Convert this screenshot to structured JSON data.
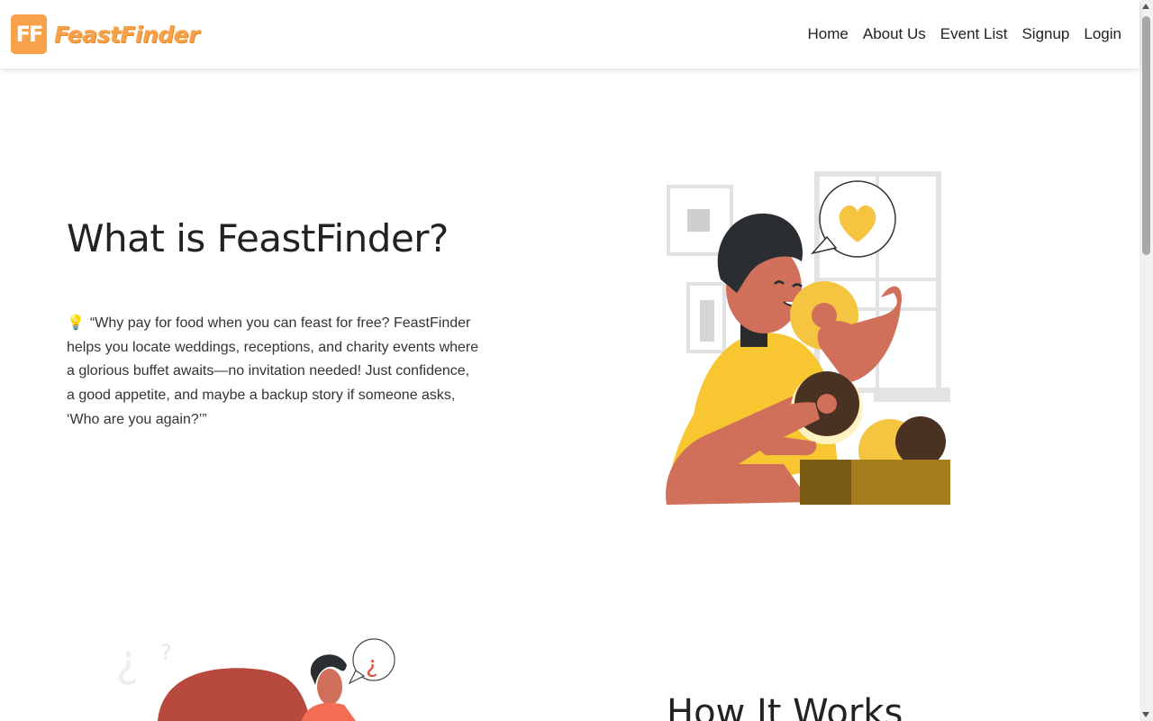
{
  "brand": {
    "logo_text": "FF",
    "name": "FeastFinder",
    "color": "#f7a14b"
  },
  "nav": {
    "items": [
      {
        "label": "Home"
      },
      {
        "label": "About Us"
      },
      {
        "label": "Event List"
      },
      {
        "label": "Signup"
      },
      {
        "label": "Login"
      }
    ]
  },
  "hero": {
    "title": "What is FeastFinder?",
    "icon": "lightbulb-icon",
    "bulb_glyph": "💡",
    "text": "“Why pay for food when you can feast for free? FeastFinder helps you locate weddings, receptions, and charity events where a glorious buffet awaits—no invitation needed! Just confidence, a good appetite, and maybe a backup story if someone asks, ‘Who are you again?’”"
  },
  "section2": {
    "title": "How It Works"
  },
  "colors": {
    "accent": "#f7a14b",
    "shirt": "#f8c630",
    "skin": "#d0705a",
    "donut": "#f5c542",
    "box": "#a47d1c"
  }
}
